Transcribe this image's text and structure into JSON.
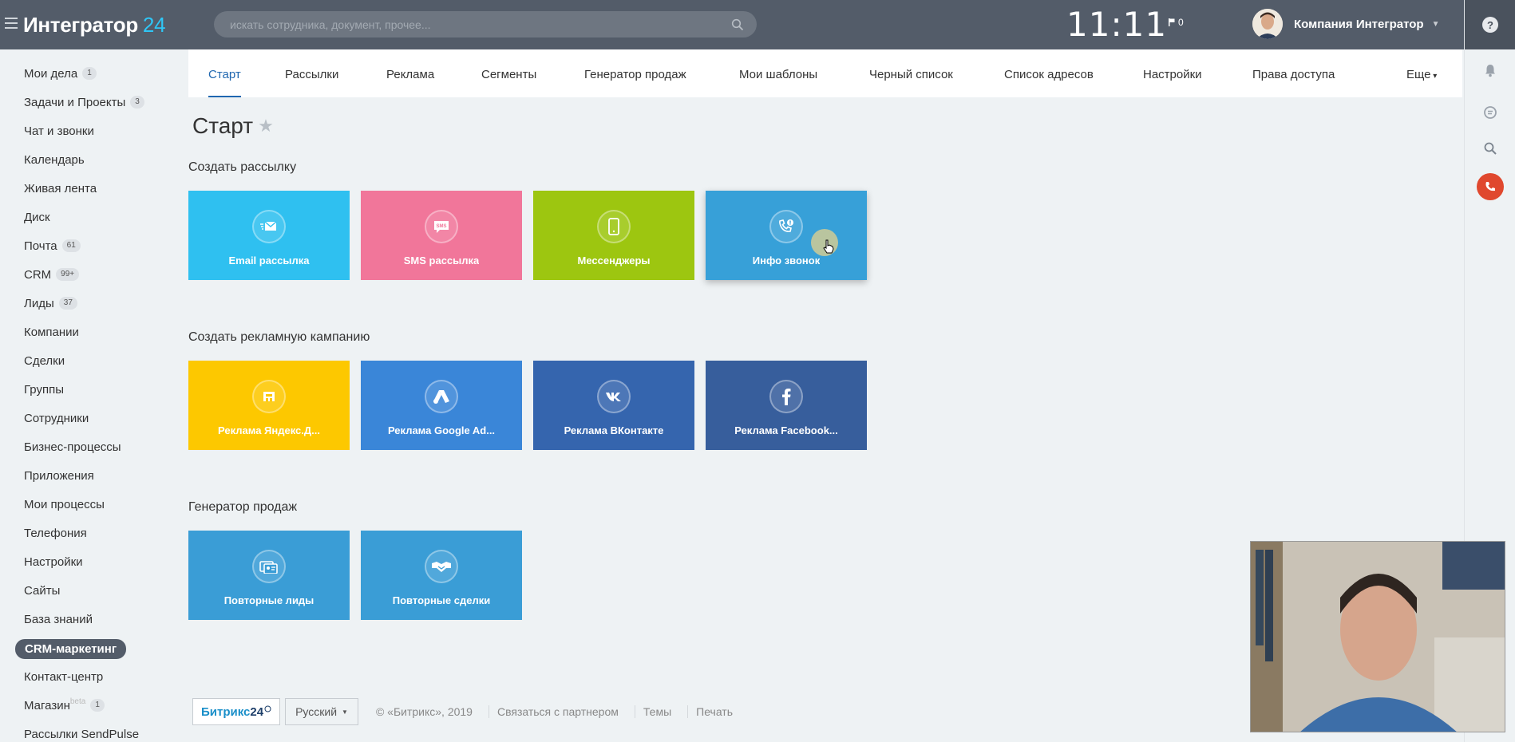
{
  "header": {
    "logo_text": "Интегратор",
    "logo_num": "24",
    "search_placeholder": "искать сотрудника, документ, прочее...",
    "clock": "11:11",
    "flag_count": "0",
    "company_name": "Компания Интегратор"
  },
  "rail": {
    "help": "?"
  },
  "menu": [
    {
      "label": "Мои дела",
      "badge": "1"
    },
    {
      "label": "Задачи и Проекты",
      "badge": "3"
    },
    {
      "label": "Чат и звонки",
      "badge": ""
    },
    {
      "label": "Календарь",
      "badge": ""
    },
    {
      "label": "Живая лента",
      "badge": ""
    },
    {
      "label": "Диск",
      "badge": ""
    },
    {
      "label": "Почта",
      "badge": "61"
    },
    {
      "label": "CRM",
      "badge": "99+"
    },
    {
      "label": "Лиды",
      "badge": "37"
    },
    {
      "label": "Компании",
      "badge": ""
    },
    {
      "label": "Сделки",
      "badge": ""
    },
    {
      "label": "Группы",
      "badge": ""
    },
    {
      "label": "Сотрудники",
      "badge": ""
    },
    {
      "label": "Бизнес-процессы",
      "badge": ""
    },
    {
      "label": "Приложения",
      "badge": ""
    },
    {
      "label": "Мои процессы",
      "badge": ""
    },
    {
      "label": "Телефония",
      "badge": ""
    },
    {
      "label": "Настройки",
      "badge": ""
    },
    {
      "label": "Сайты",
      "badge": ""
    },
    {
      "label": "База знаний",
      "badge": ""
    },
    {
      "label": "CRM-маркетинг",
      "badge": ""
    },
    {
      "label": "Контакт-центр",
      "badge": ""
    },
    {
      "label": "Магазин",
      "badge": "1",
      "sup": "beta"
    },
    {
      "label": "Рассылки SendPulse",
      "badge": ""
    }
  ],
  "tabs": [
    {
      "label": "Старт"
    },
    {
      "label": "Рассылки"
    },
    {
      "label": "Реклама"
    },
    {
      "label": "Сегменты"
    },
    {
      "label": "Генератор продаж"
    },
    {
      "label": "Мои шаблоны"
    },
    {
      "label": "Черный список"
    },
    {
      "label": "Список адресов"
    },
    {
      "label": "Настройки"
    },
    {
      "label": "Права доступа"
    },
    {
      "label": "Еще"
    }
  ],
  "page": {
    "title": "Старт",
    "sections": [
      {
        "title": "Создать рассылку",
        "tiles": [
          {
            "label": "Email рассылка",
            "color": "#2fc0f0",
            "icon": "email-icon"
          },
          {
            "label": "SMS рассылка",
            "color": "#f1769a",
            "icon": "sms-icon"
          },
          {
            "label": "Мессенджеры",
            "color": "#9dc610",
            "icon": "phone-icon"
          },
          {
            "label": "Инфо звонок",
            "color": "#37a0d8",
            "icon": "call-info-icon"
          }
        ]
      },
      {
        "title": "Создать рекламную кампанию",
        "tiles": [
          {
            "label": "Реклама Яндекс.Д...",
            "color": "#fdc800",
            "icon": "yandex-direct-icon"
          },
          {
            "label": "Реклама Google Ad...",
            "color": "#3a86d8",
            "icon": "google-ads-icon"
          },
          {
            "label": "Реклама ВКонтакте",
            "color": "#3565ae",
            "icon": "vk-icon"
          },
          {
            "label": "Реклама Facebook...",
            "color": "#375e9c",
            "icon": "facebook-icon"
          }
        ]
      },
      {
        "title": "Генератор продаж",
        "tiles": [
          {
            "label": "Повторные лиды",
            "color": "#3a9dd6",
            "icon": "repeat-leads-icon"
          },
          {
            "label": "Повторные сделки",
            "color": "#3a9dd6",
            "icon": "handshake-icon"
          }
        ]
      }
    ]
  },
  "footer": {
    "logo_text": "Битрикс",
    "logo_num": "24",
    "language": "Русский",
    "copyright": "© «Битрикс», 2019",
    "partner_link": "Связаться с партнером",
    "themes_link": "Темы",
    "print_link": "Печать"
  }
}
